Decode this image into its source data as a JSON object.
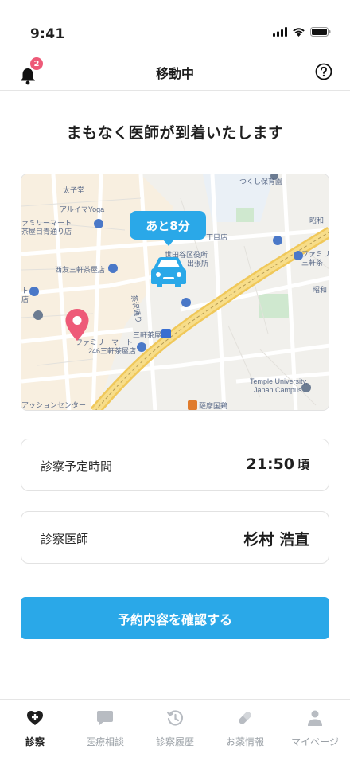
{
  "status": {
    "time": "9:41"
  },
  "nav": {
    "title": "移動中",
    "badge_count": "2"
  },
  "headline": "まもなく医師が到着いたします",
  "map": {
    "eta": "あと8分",
    "labels": [
      "太子堂",
      "アルイマYoga",
      "ァミリーマート",
      "茶屋目青通り店",
      "西友三軒茶屋店",
      "世田谷区役所",
      "出張所",
      "丁目店",
      "つくし保育園",
      "昭和",
      "ファミリ",
      "三軒茶",
      "昭和",
      "三軒茶屋",
      "茶沢通り",
      "ファミリーマート",
      "246三軒茶屋店",
      "Temple University,",
      "Japan Campus",
      "アッションセンター",
      "薩摩国鶏",
      "ト",
      "店"
    ]
  },
  "cards": {
    "time_label": "診察予定時間",
    "time_value": "21:50",
    "time_suffix": "頃",
    "doctor_label": "診察医師",
    "doctor_value": "杉村 浩直"
  },
  "confirm_button": "予約内容を確認する",
  "tabs": [
    {
      "label": "診察",
      "icon": "heart-plus-icon",
      "active": true
    },
    {
      "label": "医療相談",
      "icon": "chat-icon",
      "active": false
    },
    {
      "label": "診察履歴",
      "icon": "history-icon",
      "active": false
    },
    {
      "label": "お薬情報",
      "icon": "pill-icon",
      "active": false
    },
    {
      "label": "マイページ",
      "icon": "person-icon",
      "active": false
    }
  ],
  "colors": {
    "accent": "#2aa8e8",
    "badge": "#ee5a78",
    "pin": "#ee5a78"
  }
}
